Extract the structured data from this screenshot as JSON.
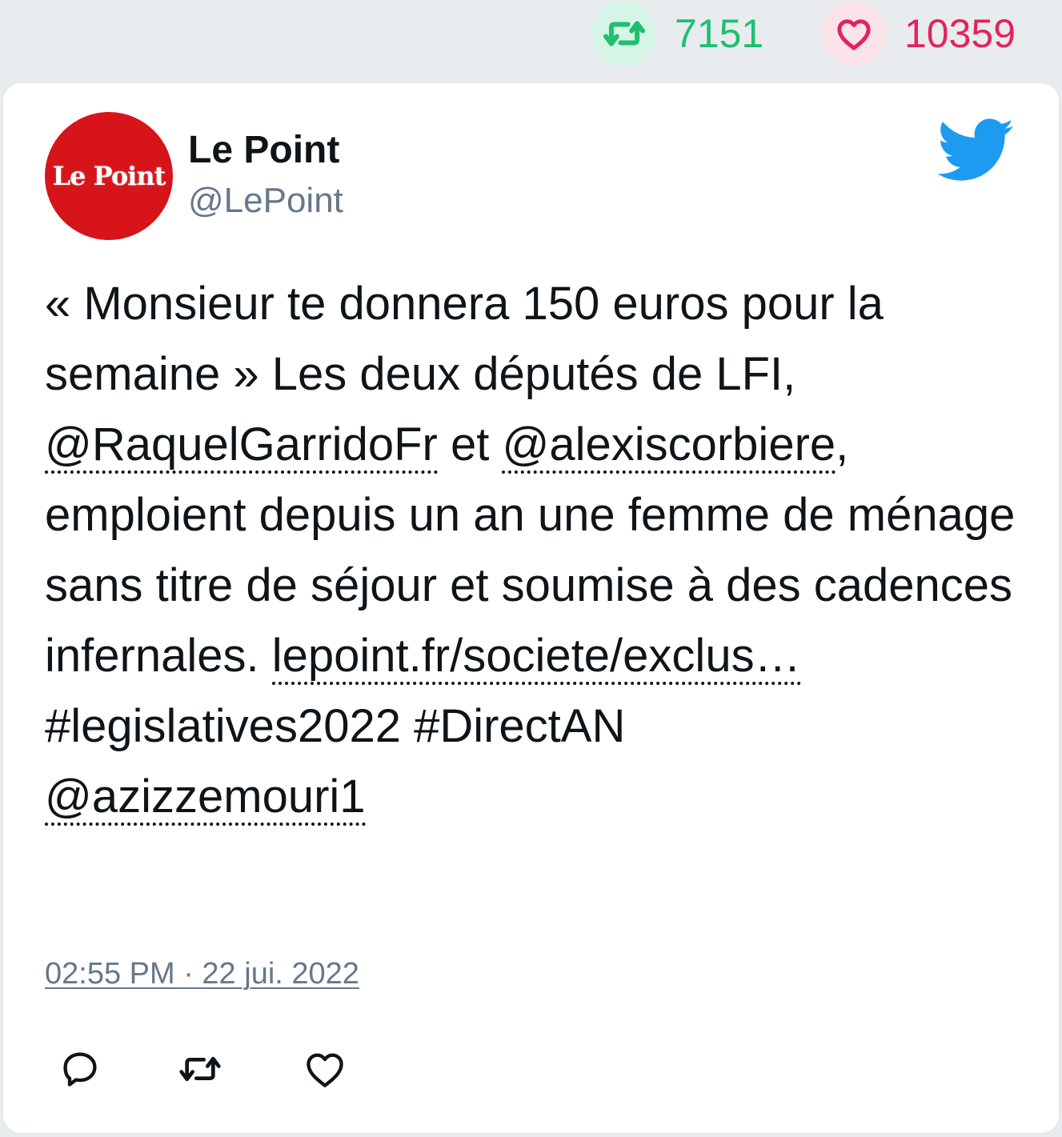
{
  "stats": {
    "retweets": "7151",
    "likes": "10359",
    "retweet_color": "#1fbf72",
    "like_color": "#e0245e"
  },
  "tweet": {
    "avatar_text": "Le Point",
    "avatar_color": "#d7141a",
    "display_name": "Le Point",
    "handle": "@LePoint",
    "text": {
      "part1": "« Monsieur te donnera 150 euros pour la semaine » Les deux députés de LFI, ",
      "mention1": "@RaquelGarridoFr",
      "part2": " et ",
      "mention2": "@alexiscorbiere",
      "part3": ", emploient depuis un an une femme de ménage sans titre de séjour et soumise à des cadences infernales. ",
      "url": "lepoint.fr/societe/exclus…",
      "hashtags": "#legislatives2022 #DirectAN",
      "mention3": "@azizzemouri1"
    },
    "timestamp": "02:55 PM · 22 jui. 2022"
  },
  "icons": {
    "brand": "twitter-bird-icon",
    "brand_color": "#1d9bf0",
    "actions": [
      "reply-icon",
      "retweet-icon",
      "like-icon"
    ]
  }
}
